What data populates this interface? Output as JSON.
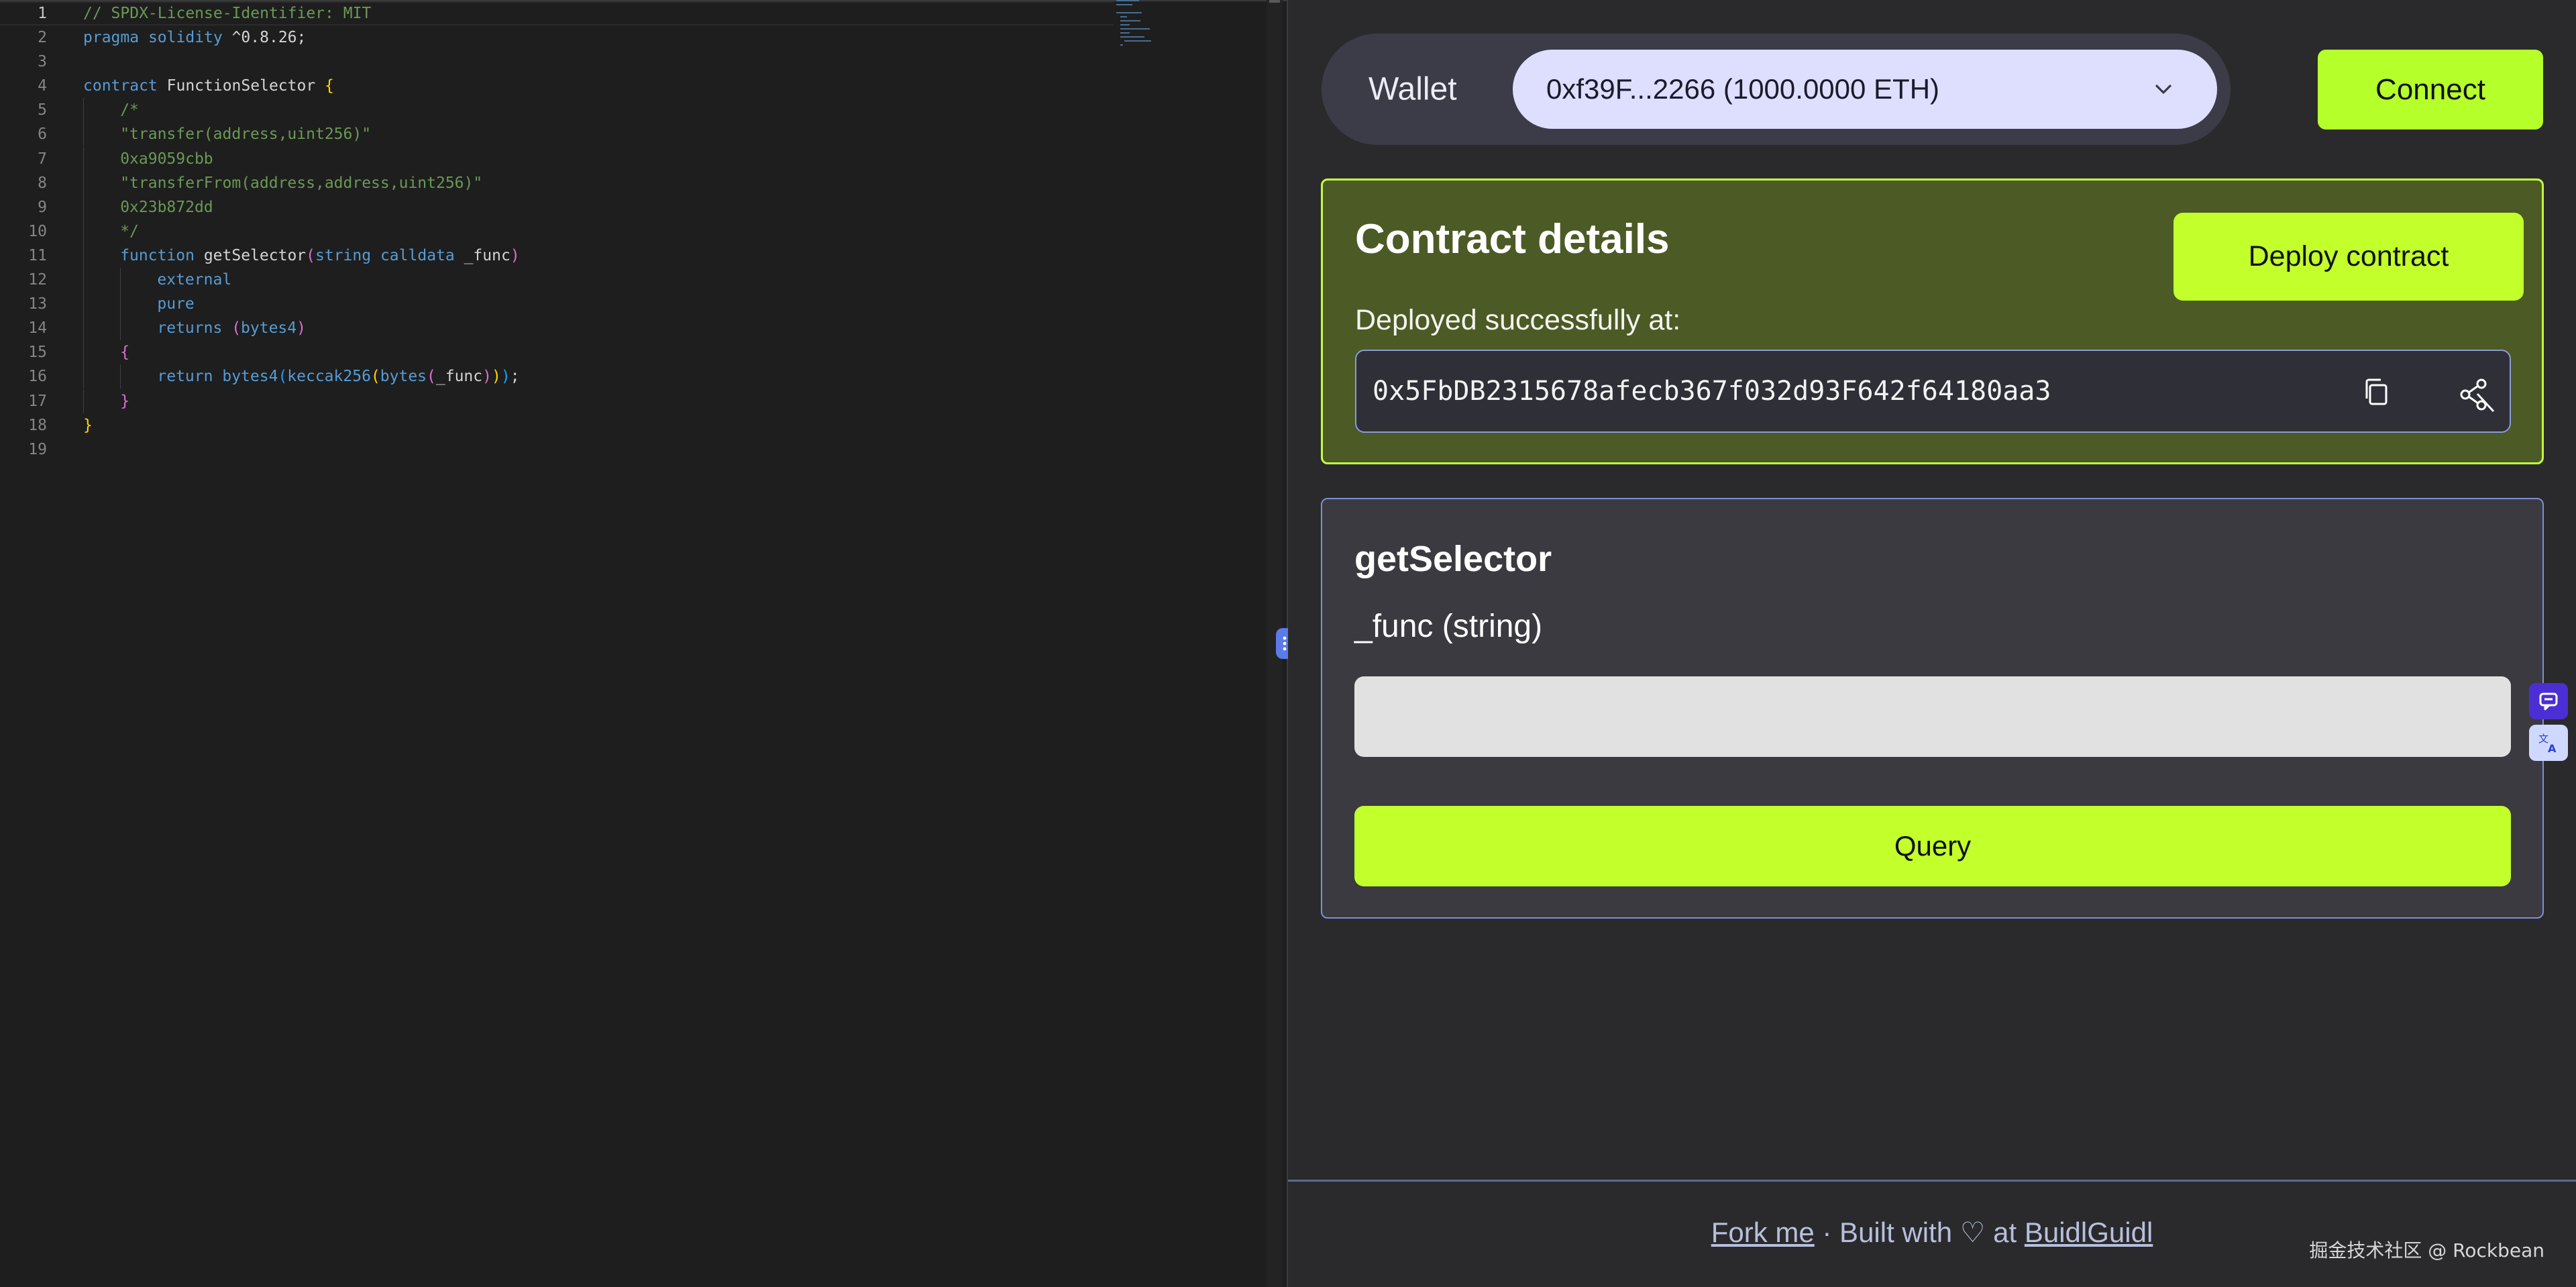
{
  "editor": {
    "lines": [
      {
        "n": "1",
        "indent": 0,
        "tokens": [
          {
            "t": "// SPDX-License-Identifier: MIT",
            "c": "t-comment"
          }
        ]
      },
      {
        "n": "2",
        "indent": 0,
        "tokens": [
          {
            "t": "pragma",
            "c": "t-kw"
          },
          {
            "t": " ",
            "c": "t-plain"
          },
          {
            "t": "solidity",
            "c": "t-kw"
          },
          {
            "t": " ^0.8.26;",
            "c": "t-plain"
          }
        ]
      },
      {
        "n": "3",
        "indent": 0,
        "tokens": []
      },
      {
        "n": "4",
        "indent": 0,
        "tokens": [
          {
            "t": "contract",
            "c": "t-kw"
          },
          {
            "t": " FunctionSelector ",
            "c": "t-plain"
          },
          {
            "t": "{",
            "c": "t-b1"
          }
        ]
      },
      {
        "n": "5",
        "indent": 1,
        "tokens": [
          {
            "t": "/*",
            "c": "t-comment"
          }
        ]
      },
      {
        "n": "6",
        "indent": 1,
        "tokens": [
          {
            "t": "\"transfer(address,uint256)\"",
            "c": "t-comment"
          }
        ]
      },
      {
        "n": "7",
        "indent": 1,
        "tokens": [
          {
            "t": "0xa9059cbb",
            "c": "t-comment"
          }
        ]
      },
      {
        "n": "8",
        "indent": 1,
        "tokens": [
          {
            "t": "\"transferFrom(address,address,uint256)\"",
            "c": "t-comment"
          }
        ]
      },
      {
        "n": "9",
        "indent": 1,
        "tokens": [
          {
            "t": "0x23b872dd",
            "c": "t-comment"
          }
        ]
      },
      {
        "n": "10",
        "indent": 1,
        "tokens": [
          {
            "t": "*/",
            "c": "t-comment"
          }
        ]
      },
      {
        "n": "11",
        "indent": 1,
        "tokens": [
          {
            "t": "function",
            "c": "t-kw"
          },
          {
            "t": " getSelector",
            "c": "t-plain"
          },
          {
            "t": "(",
            "c": "t-b2"
          },
          {
            "t": "string",
            "c": "t-kw"
          },
          {
            "t": " ",
            "c": "t-plain"
          },
          {
            "t": "calldata",
            "c": "t-kw"
          },
          {
            "t": " _func",
            "c": "t-plain"
          },
          {
            "t": ")",
            "c": "t-b2"
          }
        ]
      },
      {
        "n": "12",
        "indent": 2,
        "tokens": [
          {
            "t": "external",
            "c": "t-kw"
          }
        ]
      },
      {
        "n": "13",
        "indent": 2,
        "tokens": [
          {
            "t": "pure",
            "c": "t-kw"
          }
        ]
      },
      {
        "n": "14",
        "indent": 2,
        "tokens": [
          {
            "t": "returns",
            "c": "t-kw"
          },
          {
            "t": " ",
            "c": "t-plain"
          },
          {
            "t": "(",
            "c": "t-b2"
          },
          {
            "t": "bytes4",
            "c": "t-kw"
          },
          {
            "t": ")",
            "c": "t-b2"
          }
        ]
      },
      {
        "n": "15",
        "indent": 1,
        "tokens": [
          {
            "t": "{",
            "c": "t-b2"
          }
        ]
      },
      {
        "n": "16",
        "indent": 2,
        "tokens": [
          {
            "t": "return",
            "c": "t-kw"
          },
          {
            "t": " ",
            "c": "t-plain"
          },
          {
            "t": "bytes4",
            "c": "t-kw"
          },
          {
            "t": "(",
            "c": "t-b3"
          },
          {
            "t": "keccak256",
            "c": "t-kw"
          },
          {
            "t": "(",
            "c": "t-b1"
          },
          {
            "t": "bytes",
            "c": "t-kw"
          },
          {
            "t": "(",
            "c": "t-b2"
          },
          {
            "t": "_func",
            "c": "t-plain"
          },
          {
            "t": ")",
            "c": "t-b2"
          },
          {
            "t": ")",
            "c": "t-b1"
          },
          {
            "t": ")",
            "c": "t-b3"
          },
          {
            "t": ";",
            "c": "t-plain"
          }
        ]
      },
      {
        "n": "17",
        "indent": 1,
        "tokens": [
          {
            "t": "}",
            "c": "t-b2"
          }
        ]
      },
      {
        "n": "18",
        "indent": 0,
        "tokens": [
          {
            "t": "}",
            "c": "t-b1"
          }
        ]
      },
      {
        "n": "19",
        "indent": 0,
        "tokens": []
      }
    ]
  },
  "wallet": {
    "label": "Wallet",
    "selected": "0xf39F...2266 (1000.0000 ETH)",
    "connect_label": "Connect"
  },
  "contract": {
    "title": "Contract details",
    "deploy_label": "Deploy contract",
    "deployed_label": "Deployed successfully at:",
    "address": "0x5FbDB2315678afecb367f032d93F642f64180aa3"
  },
  "function_card": {
    "name": "getSelector",
    "param_label": "_func (string)",
    "input_value": "",
    "input_placeholder": "",
    "query_label": "Query"
  },
  "footer": {
    "fork_label": "Fork me",
    "middle_text": " · Built with ",
    "heart": "♡",
    "at_text": " at ",
    "buidl_label": "BuidlGuidl"
  },
  "watermark": "掘金技术社区 @ Rockbean",
  "colors": {
    "accent_green": "#c2ff2b",
    "card_green": "#4c5a25",
    "wallet_select": "#dedfff",
    "card_border_blue": "#7f8fd6"
  },
  "icons": {
    "wallet_chevron": "chevron-down-icon",
    "copy": "copy-icon",
    "unlink": "unlink-icon",
    "split_handle": "drag-dots-icon",
    "side_chat": "chat-icon",
    "side_translate": "translate-icon"
  }
}
